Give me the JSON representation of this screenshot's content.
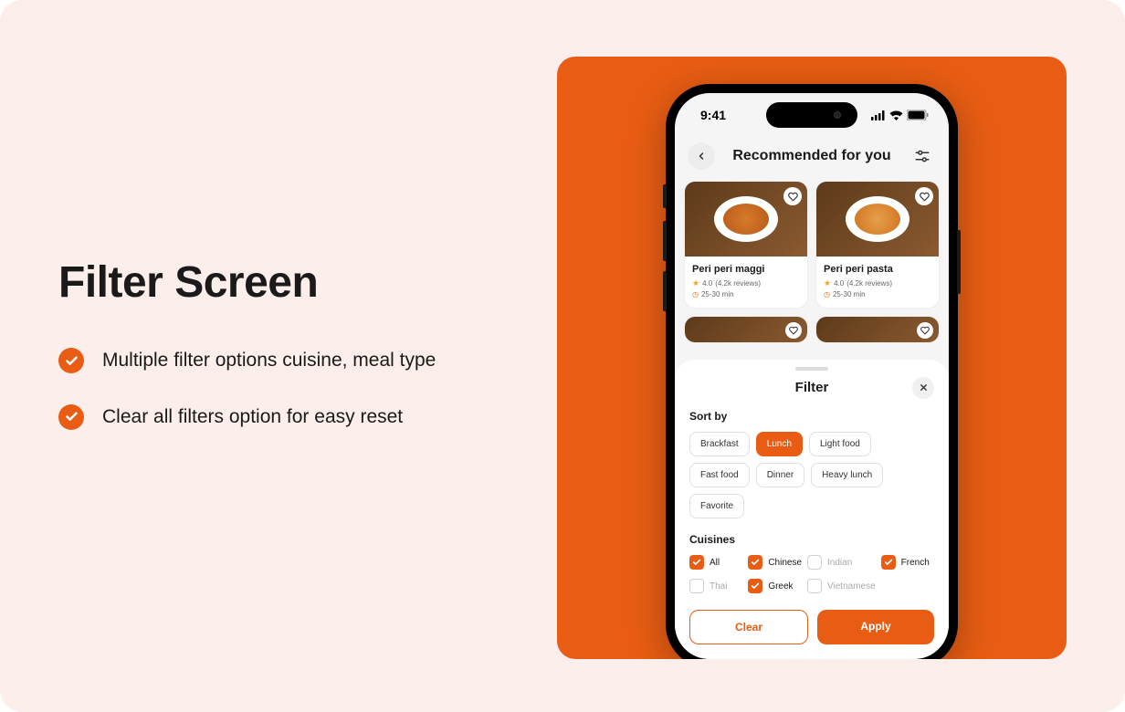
{
  "left": {
    "title": "Filter Screen",
    "features": [
      "Multiple filter options cuisine, meal type",
      "Clear all filters option for easy reset"
    ]
  },
  "phone": {
    "status": {
      "time": "9:41"
    },
    "header": {
      "title": "Recommended for you"
    },
    "cards": [
      {
        "title": "Peri peri maggi",
        "rating": "4.0",
        "reviews": "(4.2k reviews)",
        "time": "25-30 min"
      },
      {
        "title": "Peri peri pasta",
        "rating": "4.0",
        "reviews": "(4.2k reviews)",
        "time": "25-30 min"
      }
    ],
    "sheet": {
      "title": "Filter",
      "sort_label": "Sort by",
      "sort_options": [
        {
          "label": "Brackfast",
          "active": false
        },
        {
          "label": "Lunch",
          "active": true
        },
        {
          "label": "Light food",
          "active": false
        },
        {
          "label": "Fast food",
          "active": false
        },
        {
          "label": "Dinner",
          "active": false
        },
        {
          "label": "Heavy lunch",
          "active": false
        },
        {
          "label": "Favorite",
          "active": false
        }
      ],
      "cuisines_label": "Cuisines",
      "cuisines": [
        {
          "label": "All",
          "checked": true
        },
        {
          "label": "Chinese",
          "checked": true
        },
        {
          "label": "Indian",
          "checked": false
        },
        {
          "label": "French",
          "checked": true
        },
        {
          "label": "Thai",
          "checked": false
        },
        {
          "label": "Greek",
          "checked": true
        },
        {
          "label": "Vietnamese",
          "checked": false
        }
      ],
      "clear_label": "Clear",
      "apply_label": "Apply"
    }
  }
}
